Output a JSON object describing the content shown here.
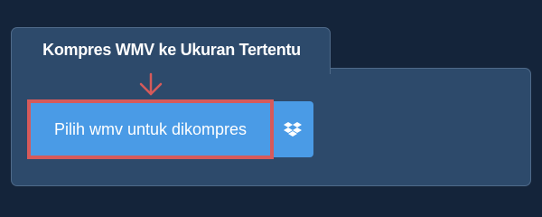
{
  "panel": {
    "title": "Kompres WMV ke Ukuran Tertentu"
  },
  "upload": {
    "button_label": "Pilih wmv untuk dikompres",
    "dropbox_icon": "dropbox-icon"
  },
  "colors": {
    "background": "#14243a",
    "panel": "#2d4a6b",
    "button": "#4a9be6",
    "highlight": "#d65a5a"
  }
}
